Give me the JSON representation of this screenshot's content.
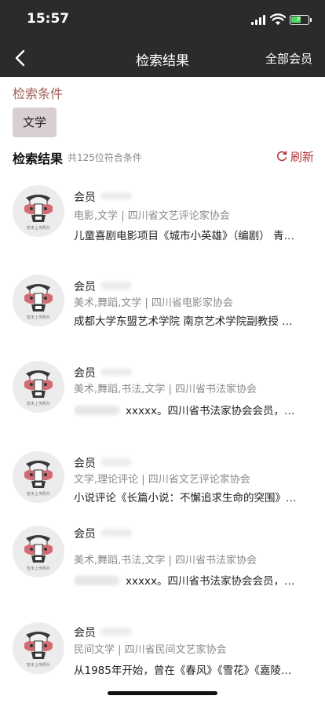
{
  "status_bar": {
    "time": "15:57"
  },
  "nav": {
    "title": "检索结果",
    "right_action": "全部会员"
  },
  "conditions": {
    "label": "检索条件",
    "chips": [
      "文学"
    ]
  },
  "results": {
    "title": "检索结果",
    "count_text": "共125位符合条件",
    "refresh_label": "刷新",
    "items": [
      {
        "name": "会员",
        "tags": "电影,文学 | 四川省文艺评论家协会",
        "desc": "儿童喜剧电影项目《城市小英雄》（编剧） 青春..."
      },
      {
        "name": "会员",
        "tags": "美术,舞蹈,文学 | 四川省电影家协会",
        "desc": "成都大学东盟艺术学院 南京艺术学院副教授 博士后"
      },
      {
        "name": "会员",
        "tags": "美术,舞蹈,书法,文学 | 四川省书法家协会",
        "desc": "xxxxx。四川省书法家协会会员，师..."
      },
      {
        "name": "会员",
        "tags": "文学,理论评论 | 四川省文艺评论家协会",
        "desc": "小说评论《长篇小说：不懈追求生命的突围》发..."
      },
      {
        "name": "会员",
        "tags": "美术,舞蹈,书法,文学 | 四川省书法家协会",
        "desc": "xxxxx。四川省书法家协会会员，师..."
      },
      {
        "name": "会员",
        "tags": "民间文学 | 四川省民间文艺家协会",
        "desc": "从1985年开始，曾在《春风》《雪花》《嘉陵江..."
      }
    ]
  },
  "avatar": {
    "caption": "暂未上传照片"
  },
  "colors": {
    "topbar": "#2b2b2b",
    "accent": "#a0625b",
    "refresh": "#b23a3a",
    "chip_bg": "#d9cfd0"
  },
  "icons": {
    "back": "chevron-left-icon",
    "refresh": "refresh-icon"
  }
}
